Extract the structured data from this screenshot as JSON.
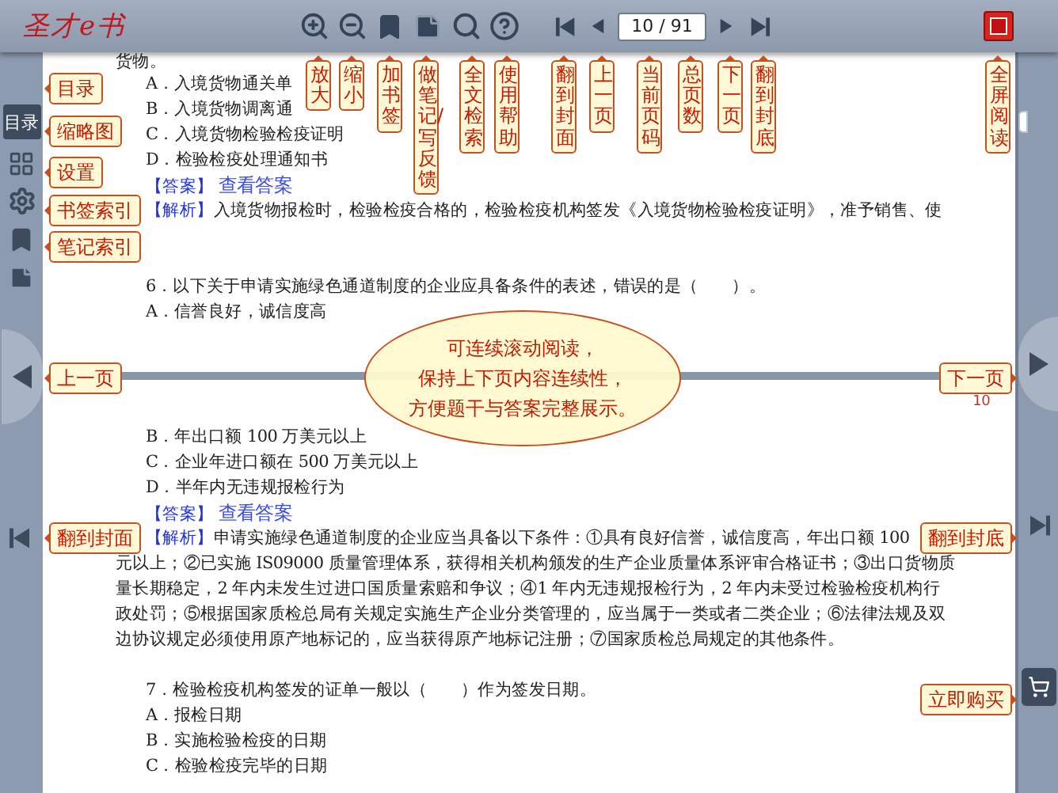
{
  "app": {
    "logo": "圣才e书"
  },
  "toolbar": {
    "page_field": {
      "value": "10 / 91"
    }
  },
  "sidebar": {
    "tabs": [
      {
        "label": "目录",
        "selected": true
      }
    ]
  },
  "document": {
    "upper_lines": [
      {
        "kind": "cut",
        "text": "货物。"
      },
      {
        "kind": "option",
        "text": "A．入境货物通关单"
      },
      {
        "kind": "option",
        "text": "B．入境货物调离通"
      },
      {
        "kind": "option",
        "text": "C．入境货物检验检疫证明"
      },
      {
        "kind": "option",
        "text": "D．检验检疫处理通知书"
      },
      {
        "kind": "answer",
        "label": "【答案】",
        "link": "查看答案"
      },
      {
        "kind": "analysis",
        "label": "【解析】",
        "text": "入境货物报检时，检验检疫合格的，检验检疫机构签发《入境货物检验检疫证明》，准予销售、使"
      },
      {
        "kind": "blank"
      },
      {
        "kind": "blank"
      },
      {
        "kind": "question",
        "text": "6．以下关于申请实施绿色通道制度的企业应具备条件的表述，错误的是（　　）。"
      },
      {
        "kind": "option",
        "text": "A．信誉良好，诚信度高"
      }
    ],
    "page_number": "10",
    "lower_lines": [
      {
        "kind": "option",
        "text": "B．年出口额 100 万美元以上"
      },
      {
        "kind": "option",
        "text": "C．企业年进口额在 500 万美元以上"
      },
      {
        "kind": "option",
        "text": "D．半年内无违规报检行为"
      },
      {
        "kind": "answer",
        "label": "【答案】",
        "link": "查看答案"
      },
      {
        "kind": "analysis",
        "label": "【解析】",
        "text": "申请实施绿色通道制度的企业应当具备以下条件：①具有良好信誉，诚信度高，年出口额 100"
      },
      {
        "kind": "body",
        "text": "元以上；②已实施 IS09000 质量管理体系，获得相关机构颁发的生产企业质量体系评审合格证书；③出口货物质"
      },
      {
        "kind": "body",
        "text": "量长期稳定，2 年内未发生过进口国质量索赔和争议；④1 年内无违规报检行为，2 年内未受过检验检疫机构行"
      },
      {
        "kind": "body",
        "text": "政处罚；⑤根据国家质检总局有关规定实施生产企业分类管理的，应当属于一类或者二类企业；⑥法律法规及双"
      },
      {
        "kind": "body",
        "text": "边协议规定必须使用原产地标记的，应当获得原产地标记注册；⑦国家质检总局规定的其他条件。"
      },
      {
        "kind": "blank"
      },
      {
        "kind": "question",
        "text": "7．检验检疫机构签发的证单一般以（　　）作为签发日期。"
      },
      {
        "kind": "option",
        "text": "A．报检日期"
      },
      {
        "kind": "option",
        "text": "B．实施检验检疫的日期"
      },
      {
        "kind": "option",
        "text": "C．检验检疫完毕的日期"
      }
    ]
  },
  "hint_bubble": {
    "lines": [
      "可连续滚动阅读，",
      "保持上下页内容连续性，",
      "方便题干与答案完整展示。"
    ]
  },
  "toolbar_callouts": [
    "放大",
    "缩小",
    "加书签",
    "做笔记/写反馈",
    "全文检索",
    "使用帮助",
    "翻到封面",
    "上一页",
    "当前页码",
    "总页数",
    "下一页",
    "翻到封底",
    "全屏阅读"
  ],
  "left_callouts": [
    "目录",
    "缩略图",
    "设置",
    "书签索引",
    "笔记索引",
    "上一页",
    "翻到封面"
  ],
  "right_callouts": [
    "下一页",
    "翻到封底",
    "立即购买"
  ]
}
